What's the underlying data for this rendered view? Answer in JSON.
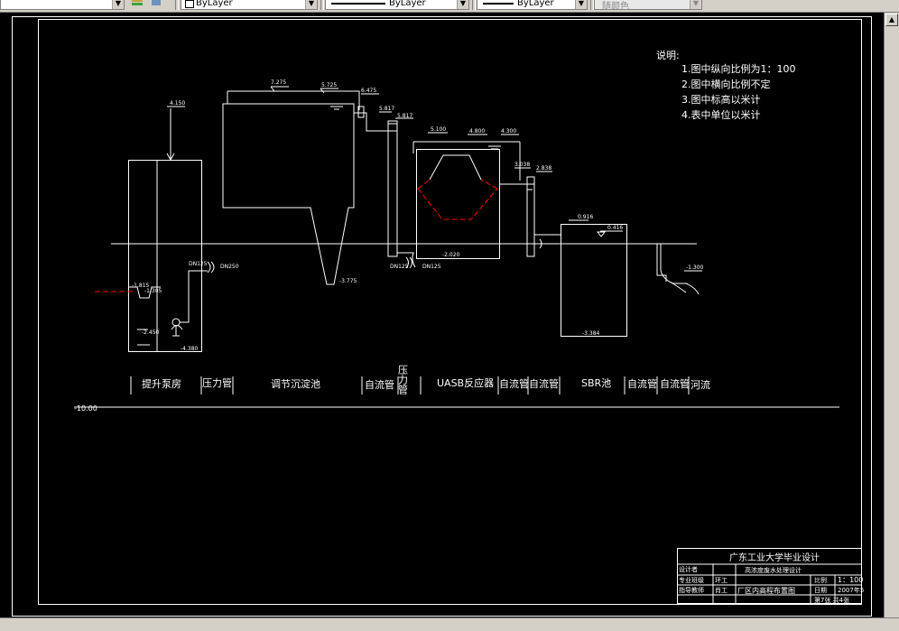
{
  "toolbar": {
    "layer_color": "ByLayer",
    "linetype": "ByLayer",
    "lineweight": "ByLayer",
    "plotstyle": "随颜色"
  },
  "notes": {
    "heading": "说明:",
    "items": [
      "1.图中纵向比例为1：100",
      "2.图中横向比例不定",
      "3.图中标高以米计",
      "4.表中单位以米计"
    ]
  },
  "elevations": {
    "e4150": "4.150",
    "e7275": "7.275",
    "e5725": "5.725",
    "e6475": "6.475",
    "e5817a": "5.817",
    "e5817b": "5.817",
    "e5100": "5.100",
    "e4800": "4.800",
    "e4300": "4.300",
    "e3038": "3.038",
    "e2838": "2.838",
    "e0916": "0.916",
    "e0416": "0.416",
    "e_1300": "-1.300",
    "e_3775": "-3.775",
    "e_2020": "-2.020",
    "e_3384": "-3.384",
    "e_4380": "-4.380",
    "e_2450": "-2.450",
    "e_1305": "-1.305",
    "e_1815": "-1.815"
  },
  "pipes": {
    "dn250": "DN250",
    "dn150a": "DN125",
    "dn150b": "DN125",
    "dn125": "DN125"
  },
  "labels": {
    "pump": "提升泵房",
    "pressure1": "压力管",
    "tank": "调节沉淀池",
    "gravity1": "自流管",
    "pressure2": "压力管",
    "uasb": "UASB反应器",
    "gravity2": "自流管",
    "gravity3": "自流管",
    "sbr": "SBR池",
    "gravity4": "自流管",
    "gravity5": "自流管",
    "river": "河流",
    "datum": "-10.00"
  },
  "title_block": {
    "school": "广东工业大学毕业设计",
    "designer": "设计者",
    "project": "高浓度废水处理设计",
    "major": "专业班级",
    "major_val": "环工",
    "advisor": "指导教师",
    "advisor_val": "肖工",
    "drawing": "厂区内高程布置图",
    "scale_label": "比例",
    "scale_value": "1：100",
    "date_label": "日期",
    "date_value": "2007年5",
    "sheet": "第7张 共4张"
  }
}
